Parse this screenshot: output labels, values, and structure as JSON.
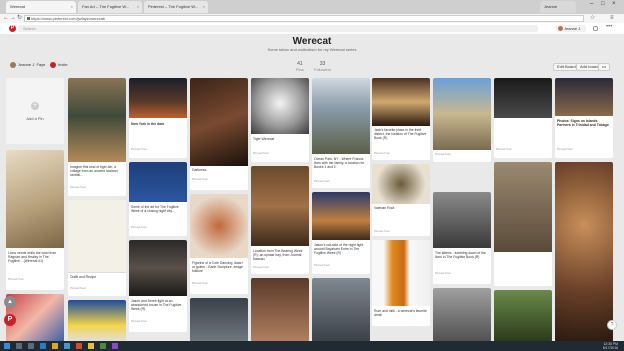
{
  "browser": {
    "tabs": [
      {
        "title": "Werecat",
        "active": true
      },
      {
        "title": "Fan Art – The Fugitive W...",
        "active": false
      },
      {
        "title": "Pinterest – The Fugitive W...",
        "active": false
      }
    ],
    "url": "https://www.pinterest.com/jwfaye/werecat/",
    "user_chip": "Jeanne"
  },
  "pinterest": {
    "search_placeholder": "Search",
    "user_name": "Jeanne J.",
    "board_title": "Werecat",
    "board_subtitle": "Some tattoo and wolfcotism for my Werecat series",
    "owner_name": "Jeanne J. Faye",
    "invite_label": "Invite",
    "stats": [
      {
        "n": "41",
        "label": "Pins"
      },
      {
        "n": "33",
        "label": "Followers"
      }
    ],
    "buttons": {
      "edit": "Edit Board",
      "add_board": "Add board",
      "more": "•••"
    },
    "add_pin_label": "Add a Pin"
  },
  "pins": [
    {
      "id": "lion",
      "caption": "Lions needs while the wind from Ragnarr and Healey in The Fugitive... (Werecat #1)",
      "source": "Pinned from"
    },
    {
      "id": "tiger-man",
      "caption": "Imagine this kind of tiger-ish, a collage from an ancient lowland rainfall...",
      "source": "Pinned from"
    },
    {
      "id": "newyork",
      "caption": "New York in the dark",
      "source": "Pinned from"
    },
    {
      "id": "rbc",
      "caption": "Some of the art for The Fugitive Week of a closing night city...",
      "source": "Pinned from"
    },
    {
      "id": "alley",
      "caption": "Jason and Derek fight at an abandoned house in The Fugitive Week (R)",
      "source": "Pinned from"
    },
    {
      "id": "man-dark",
      "caption": "Darkness",
      "source": "Pinned from"
    },
    {
      "id": "sculpture",
      "caption": "Figurine of a Cute Dancing, dwarf or golem - Earth Sculpture, Image folklore",
      "source": "Pinned from"
    },
    {
      "id": "tiger-face",
      "caption": "Tiger Werecat",
      "source": "Pinned from"
    },
    {
      "id": "room",
      "caption": "Location from The Bearing Week (R): an upstair bay, from Journal Nassau",
      "source": "Pinned from"
    },
    {
      "id": "street",
      "caption": "Ocean Park, NY - Where Francis lives with her family, a location for Books 1 and 2.",
      "source": "Pinned from"
    },
    {
      "id": "cathedral",
      "caption": "Jason's cat-side of the night fight around Bayaham Entre in The Fugitive Week (R)",
      "source": "Pinned from"
    },
    {
      "id": "tea",
      "caption": "Valerian Root",
      "source": "Pinned from"
    },
    {
      "id": "rum",
      "caption": "Rum and milk - a werecat's favorite drink!",
      "source": "Pinned from"
    },
    {
      "id": "market",
      "caption": "Jack's favorite place in the thrift district, the location of The Fugitive Book (R)",
      "source": "Pinned from"
    },
    {
      "id": "cats-grid",
      "caption": "The kittens - tumbling down of the lions in The Fugitive Book (R)",
      "source": "Pinned from"
    },
    {
      "id": "man-portrait",
      "caption": "",
      "source": ""
    },
    {
      "id": "news",
      "caption": "Photos: Signs on Islands Partners in Trinidad and Tobago",
      "source": "Pinned from"
    },
    {
      "id": "doc",
      "caption": "Outfit and Recipe",
      "source": "Pinned from"
    },
    {
      "id": "salt",
      "caption": "",
      "source": ""
    },
    {
      "id": "window",
      "caption": "",
      "source": ""
    }
  ],
  "taskbar": {
    "time": "12:30 PM",
    "date": "8/17/2016"
  },
  "colors": {
    "pinterest_red": "#cb2027",
    "background": "#e9e9e9"
  }
}
